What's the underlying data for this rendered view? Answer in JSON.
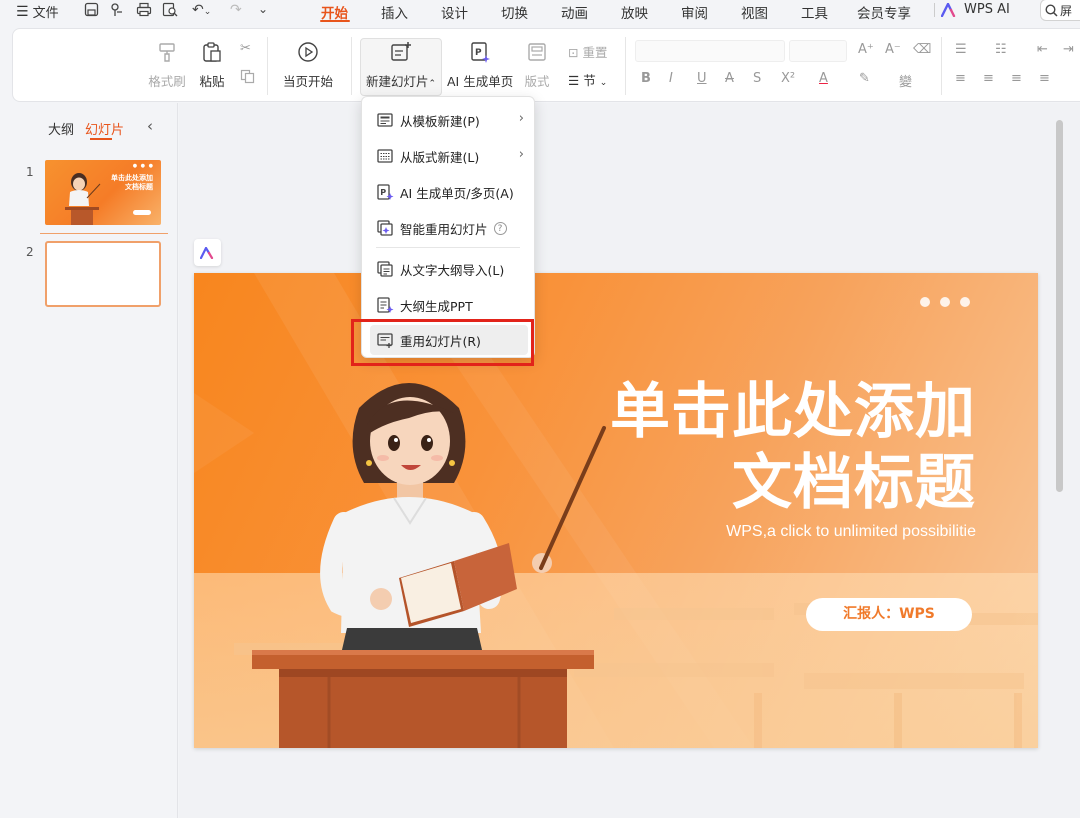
{
  "menubar": {
    "file_label": "文件",
    "tabs": [
      "开始",
      "插入",
      "设计",
      "切换",
      "动画",
      "放映",
      "审阅",
      "视图",
      "工具",
      "会员专享"
    ],
    "active_tab": "开始",
    "wps_ai_label": "WPS AI",
    "search_label": "屏"
  },
  "ribbon": {
    "format_painter": "格式刷",
    "paste": "粘贴",
    "play_from_current": "当页开始",
    "new_slide": "新建幻灯片",
    "ai_generate_page": "AI 生成单页",
    "layout": "版式",
    "reset": "重置",
    "section": "节"
  },
  "left_panel": {
    "tab_outline": "大纲",
    "tab_slides": "幻灯片",
    "slide_numbers": [
      "1",
      "2"
    ],
    "thumb1_title": "单击此处添加\n文档标题"
  },
  "slide": {
    "title_line1": "单击此处添加",
    "title_line2": "文档标题",
    "subtitle": "WPS,a click to unlimited possibilitie",
    "reporter": "汇报人：WPS"
  },
  "dropdown": {
    "items": [
      {
        "label": "从模板新建(P)",
        "has_submenu": true
      },
      {
        "label": "从版式新建(L)",
        "has_submenu": true
      },
      {
        "label": "AI 生成单页/多页(A)",
        "has_submenu": false
      },
      {
        "label": "智能重用幻灯片",
        "has_submenu": false,
        "has_help": true
      },
      {
        "label": "从文字大纲导入(L)",
        "has_submenu": false
      },
      {
        "label": "大纲生成PPT",
        "has_submenu": false
      },
      {
        "label": "重用幻灯片(R)",
        "has_submenu": false,
        "highlighted": true
      }
    ]
  },
  "colors": {
    "accent": "#e8551c",
    "highlight_box": "#e2231a",
    "slide_orange": "#f8861e"
  }
}
